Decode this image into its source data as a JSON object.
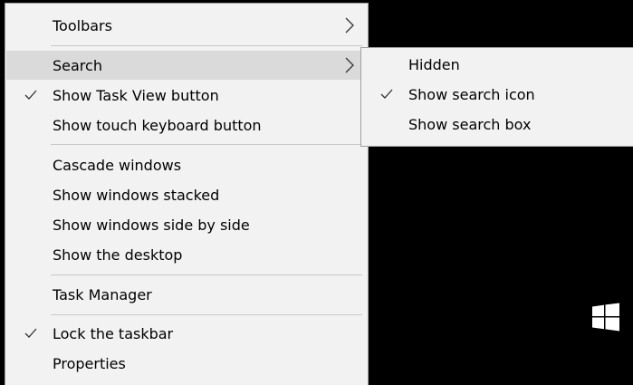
{
  "context_menu": {
    "items": [
      {
        "label": "Toolbars",
        "checked": false,
        "submenu": true
      },
      {
        "label": "Search",
        "checked": false,
        "submenu": true,
        "highlighted": true
      },
      {
        "label": "Show Task View button",
        "checked": true
      },
      {
        "label": "Show touch keyboard button",
        "checked": false
      },
      {
        "label": "Cascade windows",
        "checked": false
      },
      {
        "label": "Show windows stacked",
        "checked": false
      },
      {
        "label": "Show windows side by side",
        "checked": false
      },
      {
        "label": "Show the desktop",
        "checked": false
      },
      {
        "label": "Task Manager",
        "checked": false
      },
      {
        "label": "Lock the taskbar",
        "checked": true
      },
      {
        "label": "Properties",
        "checked": false
      }
    ]
  },
  "search_submenu": {
    "items": [
      {
        "label": "Hidden",
        "checked": false
      },
      {
        "label": "Show search icon",
        "checked": true
      },
      {
        "label": "Show search box",
        "checked": false
      }
    ]
  },
  "icons": {
    "check": "checkmark-icon",
    "submenu_arrow": "chevron-right-icon",
    "start": "windows-logo-icon"
  },
  "colors": {
    "menu_background": "#f2f2f2",
    "highlight": "#dadada",
    "taskbar": "#000000",
    "logo": "#ffffff"
  }
}
